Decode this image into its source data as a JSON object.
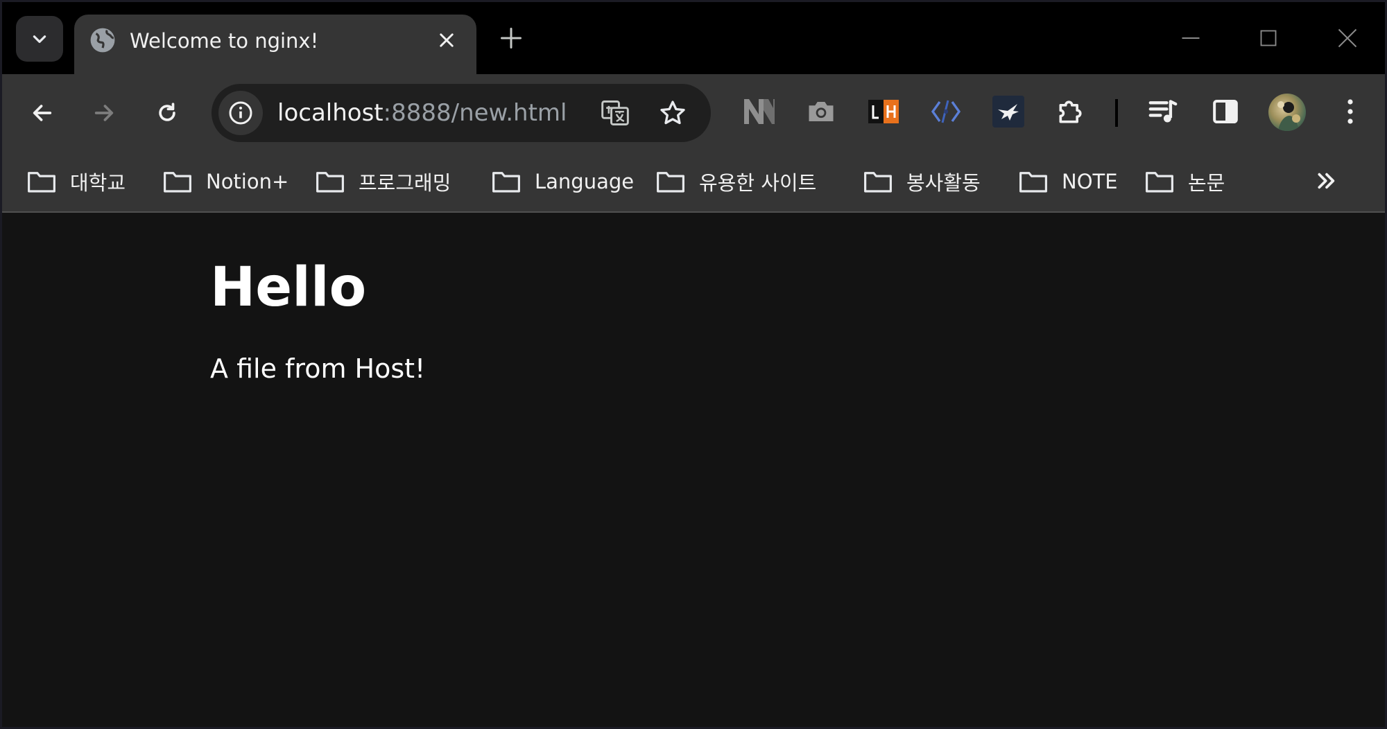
{
  "tab": {
    "title": "Welcome to nginx!"
  },
  "omnibox": {
    "url_host": "localhost",
    "url_rest": ":8888/new.html"
  },
  "bookmarks": [
    {
      "label": "대학교"
    },
    {
      "label": "Notion+"
    },
    {
      "label": "프로그래밍"
    },
    {
      "label": "Language"
    },
    {
      "label": "유용한 사이트"
    },
    {
      "label": "봉사활동"
    },
    {
      "label": "NOTE"
    },
    {
      "label": "논문"
    }
  ],
  "page": {
    "heading": "Hello",
    "paragraph": "A file from Host!"
  },
  "colors": {
    "frame": "#000000",
    "toolbar": "#353535",
    "page_bg": "#131313",
    "text": "#ffffff"
  }
}
